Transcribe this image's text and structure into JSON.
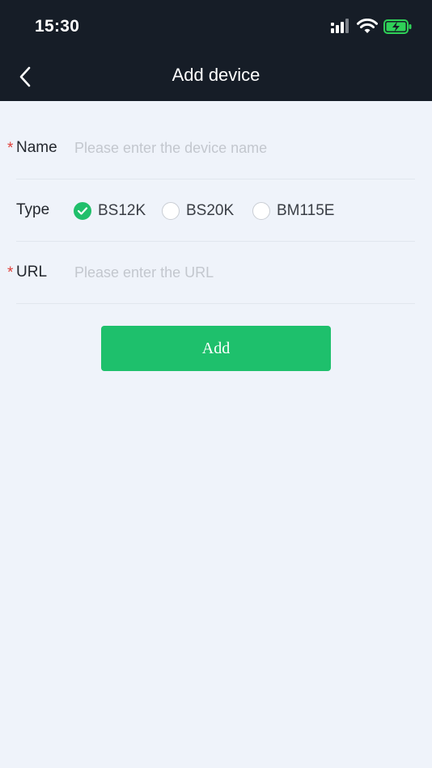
{
  "status_bar": {
    "time": "15:30",
    "icons": [
      "signal-icon",
      "wifi-icon",
      "battery-charging-icon"
    ]
  },
  "header": {
    "back_icon": "chevron-left-icon",
    "title": "Add device"
  },
  "form": {
    "required_mark": "*",
    "name": {
      "label": "Name",
      "value": "",
      "placeholder": "Please enter the device name"
    },
    "type": {
      "label": "Type",
      "options": [
        {
          "label": "BS12K",
          "selected": true
        },
        {
          "label": "BS20K",
          "selected": false
        },
        {
          "label": "BM115E",
          "selected": false
        }
      ]
    },
    "url": {
      "label": "URL",
      "value": "",
      "placeholder": "Please enter the URL"
    }
  },
  "actions": {
    "add_label": "Add"
  },
  "colors": {
    "header_bg": "#161d27",
    "page_bg": "#eff3fa",
    "accent_green": "#1ec06c",
    "required_red": "#e0403b"
  }
}
